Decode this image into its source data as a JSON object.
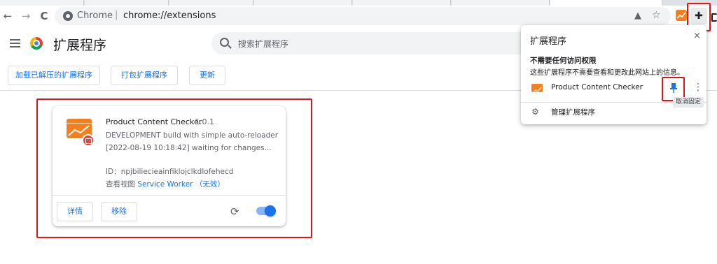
{
  "browser": {
    "omnibox_scheme": "Chrome",
    "omnibox_sep": "|",
    "url": "chrome://extensions"
  },
  "icons": {
    "back": "back-arrow-icon",
    "forward": "forward-arrow-icon",
    "reload": "reload-icon",
    "share": "share-icon",
    "star": "bookmark-star-icon",
    "puzzle": "puzzle-piece-icon"
  },
  "page": {
    "title": "扩展程序",
    "search_placeholder": "搜索扩展程序"
  },
  "actions": {
    "load_unpacked": "加载已解压的扩展程序",
    "pack": "打包扩展程序",
    "update": "更新"
  },
  "extension": {
    "name": "Product Content Checker",
    "version": "1.0.1",
    "description_line1": "DEVELOPMENT build with simple auto-reloader",
    "description_line2": "[2022-08-19 10:18:42] waiting for changes...",
    "id_label": "ID：",
    "id": "npjbiliecieainfiklojclkdlofehecd",
    "views_label": "查看视图 ",
    "service_worker_link": "Service Worker （无效）",
    "details_button": "详情",
    "remove_button": "移除",
    "enabled": true
  },
  "popup": {
    "title": "扩展程序",
    "close": "×",
    "subtitle": "不需要任何访问权限",
    "description": "这些扩展程序不需要查看和更改此网站上的信息。",
    "item_name": "Product Content Checker",
    "tooltip": "取消固定",
    "manage": "管理扩展程序",
    "pinned": true
  },
  "colors": {
    "accent": "#1a73e8",
    "extension_orange": "#f4811f",
    "highlight_red": "#e0151c"
  }
}
